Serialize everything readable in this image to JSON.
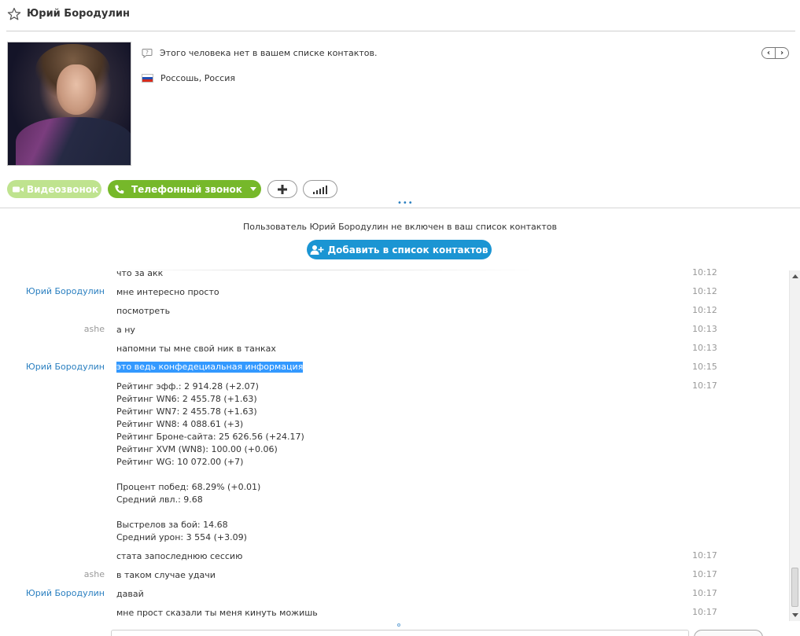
{
  "header": {
    "contact_name": "Юрий Бородулин"
  },
  "profile": {
    "not_in_contacts": "Этого человека нет в вашем списке контактов.",
    "location": "Россошь, Россия",
    "flag_colors": [
      "#ffffff",
      "#1f4fb5",
      "#d52b1e"
    ]
  },
  "actions": {
    "video_call": "Видеозвонок",
    "phone_call": "Телефонный звонок"
  },
  "notice": {
    "text": "Пользователь Юрий Бородулин не включен в ваш список контактов",
    "add_button": "Добавить в список контактов"
  },
  "chat": {
    "messages": [
      {
        "sender": "",
        "text": "что за акк",
        "time": "10:12"
      },
      {
        "sender": "Юрий Бородулин",
        "text": "мне интересно просто",
        "time": "10:12"
      },
      {
        "sender": "",
        "text": "посмотреть",
        "time": "10:12"
      },
      {
        "sender": "ashe",
        "text": "а ну",
        "time": "10:13"
      },
      {
        "sender": "",
        "text": "напомни ты мне свой ник в танках",
        "time": "10:13"
      },
      {
        "sender": "Юрий Бородулин",
        "text": "это ведь конфедециальная информация",
        "time": "10:15"
      },
      {
        "sender": "",
        "text": "Рейтинг эфф.: 2 914.28 (+2.07)\nРейтинг WN6: 2 455.78 (+1.63)\nРейтинг WN7: 2 455.78 (+1.63)\nРейтинг WN8: 4 088.61 (+3)\nРейтинг Броне-сайта: 25 626.56 (+24.17)\nРейтинг XVM (WN8): 100.00 (+0.06)\nРейтинг WG: 10 072.00 (+7)\n\nПроцент побед: 68.29% (+0.01)\nСредний лвл.: 9.68\n\nВыстрелов за бой: 14.68\nСредний урон: 3 554 (+3.09)",
        "time": "10:17"
      },
      {
        "sender": "",
        "text": "стата запоследнюю сессию",
        "time": "10:17"
      },
      {
        "sender": "ashe",
        "text": "в таком случае удачи",
        "time": "10:17"
      },
      {
        "sender": "Юрий Бородулин",
        "text": "давай",
        "time": "10:17"
      },
      {
        "sender": "",
        "text": "мне прост сказали ты меня кинуть можишь",
        "time": "10:17"
      }
    ]
  },
  "colors": {
    "accent_blue": "#1b95d3",
    "call_green": "#76b82a",
    "video_green_disabled": "#bfe38f",
    "sender_link": "#2a7fc0",
    "selection": "#3399ff"
  }
}
